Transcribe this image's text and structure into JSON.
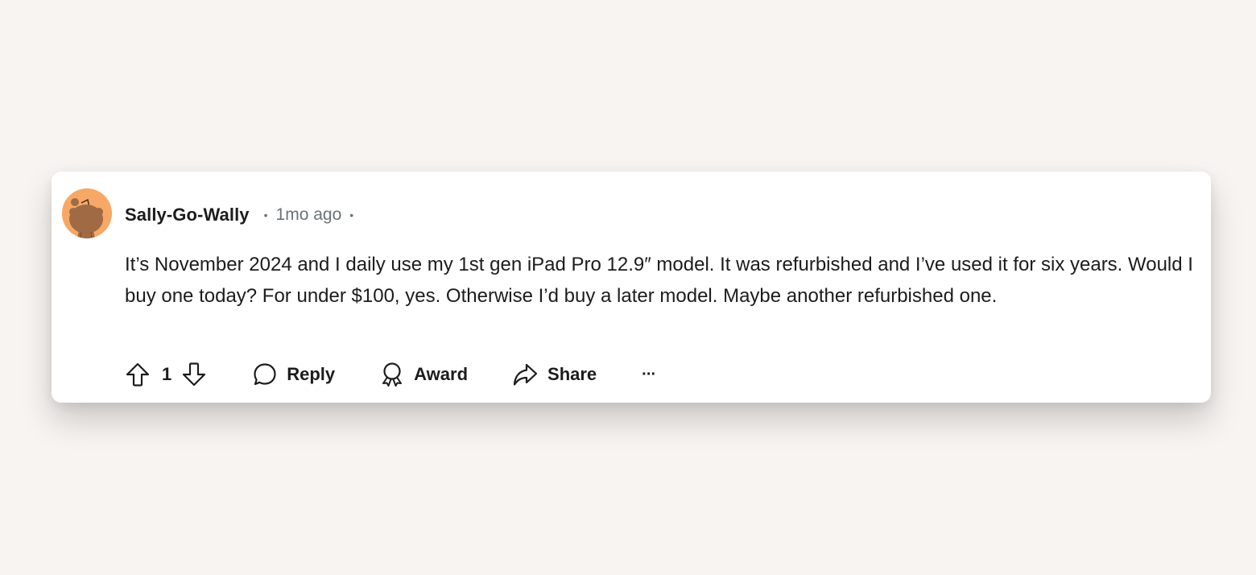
{
  "comment": {
    "author": "Sally-Go-Wally",
    "separator": "•",
    "time": "1mo ago",
    "avatar_icon": "reddit-snoo-avatar",
    "avatar_color": "#f7a866",
    "body": "It’s November 2024 and I daily use my 1st gen iPad Pro 12.9″ model. It was refurbished and I’ve used it for six years. Would I buy one today? For under $100, yes. Otherwise I’d buy a later model. Maybe another refurbished one.",
    "score": "1",
    "actions": {
      "upvote_icon": "arrow-up-outline-icon",
      "downvote_icon": "arrow-down-outline-icon",
      "reply_label": "Reply",
      "reply_icon": "speech-bubble-icon",
      "award_label": "Award",
      "award_icon": "award-ribbon-icon",
      "share_label": "Share",
      "share_icon": "share-arrow-icon",
      "more_icon": "ellipsis-icon",
      "more_glyph": "···"
    }
  },
  "colors": {
    "page_background": "#f8f4f1",
    "card_background": "#ffffff",
    "text_primary": "#1c1c1c",
    "text_meta": "#6a7378"
  }
}
